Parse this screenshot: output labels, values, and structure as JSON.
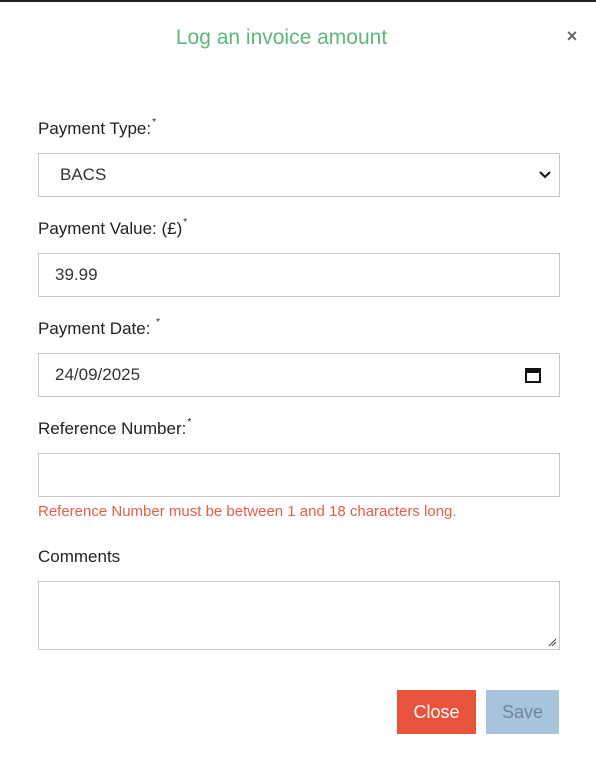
{
  "dialog": {
    "title": "Log an invoice amount",
    "close_icon": "×"
  },
  "form": {
    "payment_type": {
      "label": "Payment Type:",
      "required": "*",
      "value": "BACS"
    },
    "payment_value": {
      "label": "Payment Value: (£)",
      "required": "*",
      "value": "39.99"
    },
    "payment_date": {
      "label": "Payment Date: ",
      "required": "*",
      "value": "24/09/2025"
    },
    "reference_number": {
      "label": "Reference Number:",
      "required": "*",
      "value": "",
      "error": "Reference Number must be between 1 and 18 characters long."
    },
    "comments": {
      "label": "Comments",
      "value": ""
    }
  },
  "buttons": {
    "close": "Close",
    "save": "Save"
  },
  "colors": {
    "title": "#5cb87a",
    "error": "#e0604a",
    "close_button": "#e8533d",
    "save_button_disabled": "#a8c3dc"
  },
  "icons": {
    "select": "chevron-down-icon",
    "date": "calendar-icon",
    "dialog_close": "close-icon"
  }
}
